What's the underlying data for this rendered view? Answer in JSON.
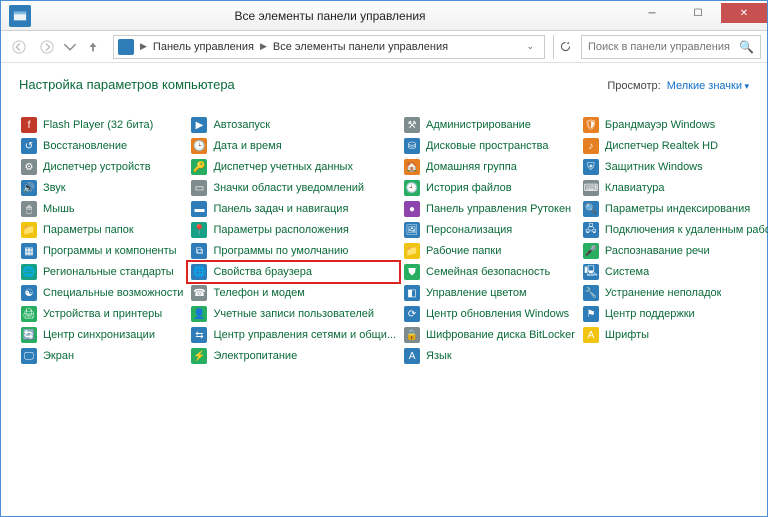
{
  "window": {
    "title": "Все элементы панели управления"
  },
  "breadcrumb": {
    "seg1": "Панель управления",
    "seg2": "Все элементы панели управления"
  },
  "search": {
    "placeholder": "Поиск в панели управления"
  },
  "header": {
    "title": "Настройка параметров компьютера",
    "view_label": "Просмотр:",
    "view_value": "Мелкие значки"
  },
  "cols": [
    [
      {
        "label": "Flash Player (32 бита)",
        "ic": "ic-red",
        "g": "f"
      },
      {
        "label": "Восстановление",
        "ic": "ic-blue",
        "g": "↺"
      },
      {
        "label": "Диспетчер устройств",
        "ic": "ic-grey",
        "g": "⚙"
      },
      {
        "label": "Звук",
        "ic": "ic-blue",
        "g": "🔊"
      },
      {
        "label": "Мышь",
        "ic": "ic-grey",
        "g": "🖱"
      },
      {
        "label": "Параметры папок",
        "ic": "ic-yellow",
        "g": "📁"
      },
      {
        "label": "Программы и компоненты",
        "ic": "ic-blue",
        "g": "▦"
      },
      {
        "label": "Региональные стандарты",
        "ic": "ic-teal",
        "g": "🌐"
      },
      {
        "label": "Специальные возможности",
        "ic": "ic-blue",
        "g": "☯"
      },
      {
        "label": "Устройства и принтеры",
        "ic": "ic-green",
        "g": "🖨"
      },
      {
        "label": "Центр синхронизации",
        "ic": "ic-green",
        "g": "🔄"
      },
      {
        "label": "Экран",
        "ic": "ic-blue",
        "g": "🖵"
      }
    ],
    [
      {
        "label": "Автозапуск",
        "ic": "ic-blue",
        "g": "▶"
      },
      {
        "label": "Дата и время",
        "ic": "ic-orange",
        "g": "🕒"
      },
      {
        "label": "Диспетчер учетных данных",
        "ic": "ic-green",
        "g": "🔑"
      },
      {
        "label": "Значки области уведомлений",
        "ic": "ic-grey",
        "g": "▭"
      },
      {
        "label": "Панель задач и навигация",
        "ic": "ic-blue",
        "g": "▬"
      },
      {
        "label": "Параметры расположения",
        "ic": "ic-teal",
        "g": "📍"
      },
      {
        "label": "Программы по умолчанию",
        "ic": "ic-blue",
        "g": "⧉"
      },
      {
        "label": "Свойства браузера",
        "ic": "ic-blue",
        "g": "🌐",
        "hl": true
      },
      {
        "label": "Телефон и модем",
        "ic": "ic-grey",
        "g": "☎"
      },
      {
        "label": "Учетные записи пользователей",
        "ic": "ic-green",
        "g": "👤"
      },
      {
        "label": "Центр управления сетями и общи...",
        "ic": "ic-blue",
        "g": "⇆"
      },
      {
        "label": "Электропитание",
        "ic": "ic-green",
        "g": "⚡"
      }
    ],
    [
      {
        "label": "Администрирование",
        "ic": "ic-grey",
        "g": "⚒"
      },
      {
        "label": "Дисковые пространства",
        "ic": "ic-blue",
        "g": "⛁"
      },
      {
        "label": "Домашняя группа",
        "ic": "ic-orange",
        "g": "🏠"
      },
      {
        "label": "История файлов",
        "ic": "ic-green",
        "g": "🕘"
      },
      {
        "label": "Панель управления Рутокен",
        "ic": "ic-purple",
        "g": "●"
      },
      {
        "label": "Персонализация",
        "ic": "ic-blue",
        "g": "🖼"
      },
      {
        "label": "Рабочие папки",
        "ic": "ic-yellow",
        "g": "📁"
      },
      {
        "label": "Семейная безопасность",
        "ic": "ic-green",
        "g": "⛊"
      },
      {
        "label": "Управление цветом",
        "ic": "ic-blue",
        "g": "◧"
      },
      {
        "label": "Центр обновления Windows",
        "ic": "ic-blue",
        "g": "⟳"
      },
      {
        "label": "Шифрование диска BitLocker",
        "ic": "ic-grey",
        "g": "🔒"
      },
      {
        "label": "Язык",
        "ic": "ic-blue",
        "g": "A"
      }
    ],
    [
      {
        "label": "Брандмауэр Windows",
        "ic": "ic-orange",
        "g": "🛡"
      },
      {
        "label": "Диспетчер Realtek HD",
        "ic": "ic-orange",
        "g": "♪"
      },
      {
        "label": "Защитник Windows",
        "ic": "ic-blue",
        "g": "⛨"
      },
      {
        "label": "Клавиатура",
        "ic": "ic-grey",
        "g": "⌨"
      },
      {
        "label": "Параметры индексирования",
        "ic": "ic-blue",
        "g": "🔍"
      },
      {
        "label": "Подключения к удаленным рабоч...",
        "ic": "ic-blue",
        "g": "🖧"
      },
      {
        "label": "Распознавание речи",
        "ic": "ic-green",
        "g": "🎤"
      },
      {
        "label": "Система",
        "ic": "ic-blue",
        "g": "🖳"
      },
      {
        "label": "Устранение неполадок",
        "ic": "ic-blue",
        "g": "🔧"
      },
      {
        "label": "Центр поддержки",
        "ic": "ic-blue",
        "g": "⚑"
      },
      {
        "label": "Шрифты",
        "ic": "ic-yellow",
        "g": "A"
      }
    ]
  ]
}
